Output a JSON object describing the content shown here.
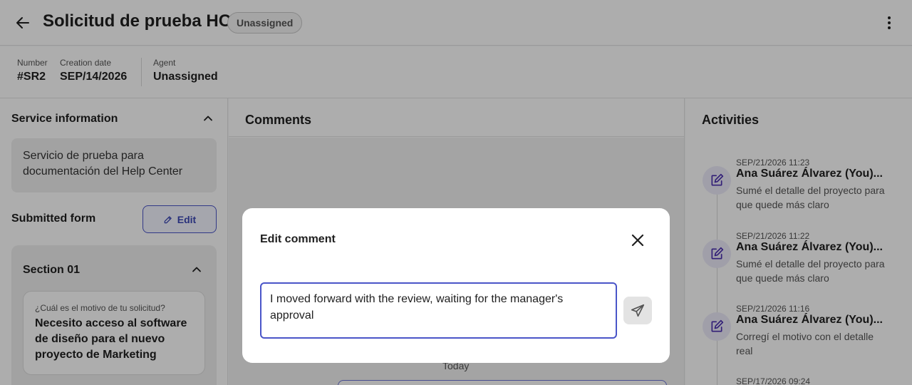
{
  "header": {
    "title": "Solicitud de prueba HC",
    "status_badge": "Unassigned"
  },
  "meta": {
    "number_label": "Number",
    "number_value": "#SR2",
    "creation_label": "Creation date",
    "creation_value": "SEP/14/2026",
    "agent_label": "Agent",
    "agent_value": "Unassigned"
  },
  "left_panel": {
    "service_info_title": "Service information",
    "service_description": "Servicio de prueba para documentación del Help Center",
    "submitted_form_title": "Submitted form",
    "edit_label": "Edit",
    "section_title": "Section 01",
    "question_label": "¿Cuál es el motivo de tu solicitud?",
    "question_answer": "Necesito acceso al software de diseño para el nuevo proyecto de Marketing"
  },
  "comments": {
    "title": "Comments",
    "date_divider": "Today"
  },
  "activities": {
    "title": "Activities",
    "items": [
      {
        "time": "SEP/21/2026 11:23",
        "user": "Ana Suárez Álvarez (You)...",
        "description": "Sumé el detalle del proyecto para que quede más claro"
      },
      {
        "time": "SEP/21/2026 11:22",
        "user": "Ana Suárez Álvarez (You)...",
        "description": "Sumé el detalle del proyecto para que quede más claro"
      },
      {
        "time": "SEP/21/2026 11:16",
        "user": "Ana Suárez Álvarez (You)...",
        "description": "Corregí el motivo con el detalle real"
      },
      {
        "time": "SEP/17/2026 09:24",
        "user": "",
        "description": ""
      }
    ]
  },
  "modal": {
    "title": "Edit comment",
    "comment_value": "I moved forward with the review, waiting for the manager's approval"
  },
  "colors": {
    "accent": "#4a55c8",
    "activity_icon": "#4b2fb0"
  }
}
